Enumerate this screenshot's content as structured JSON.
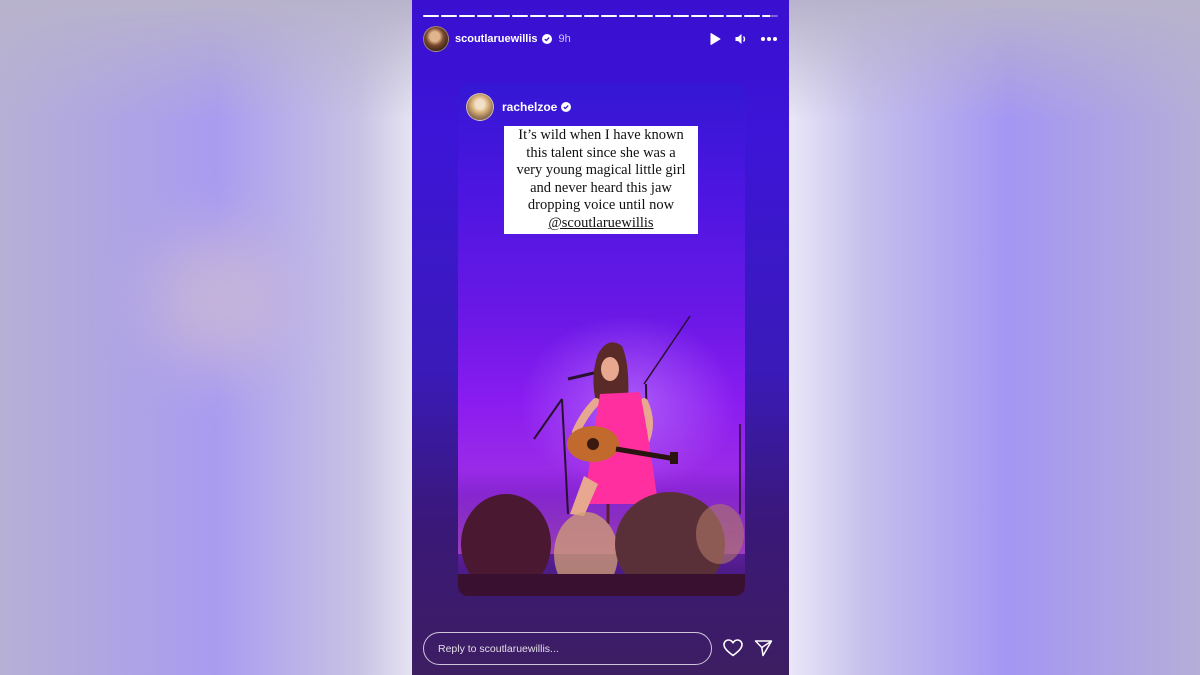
{
  "story": {
    "progress_segments": 20,
    "header": {
      "username": "scoutlaruewillis",
      "time": "9h",
      "icons": [
        "play-icon",
        "volume-icon",
        "more-icon"
      ]
    },
    "shared_post": {
      "username": "rachelzoe",
      "caption_lines": [
        "It’s wild when I have known",
        "this talent since she was a",
        "very young magical little girl",
        "and never heard this jaw",
        "dropping voice until now"
      ],
      "mention": "@scoutlaruewillis"
    },
    "reply": {
      "placeholder": "Reply to scoutlaruewillis..."
    },
    "actions": [
      "heart-icon",
      "send-icon"
    ]
  },
  "colors": {
    "story_bg": "#3a12c8",
    "accent_pink": "#ff3aa0",
    "text": "#ffffff"
  }
}
